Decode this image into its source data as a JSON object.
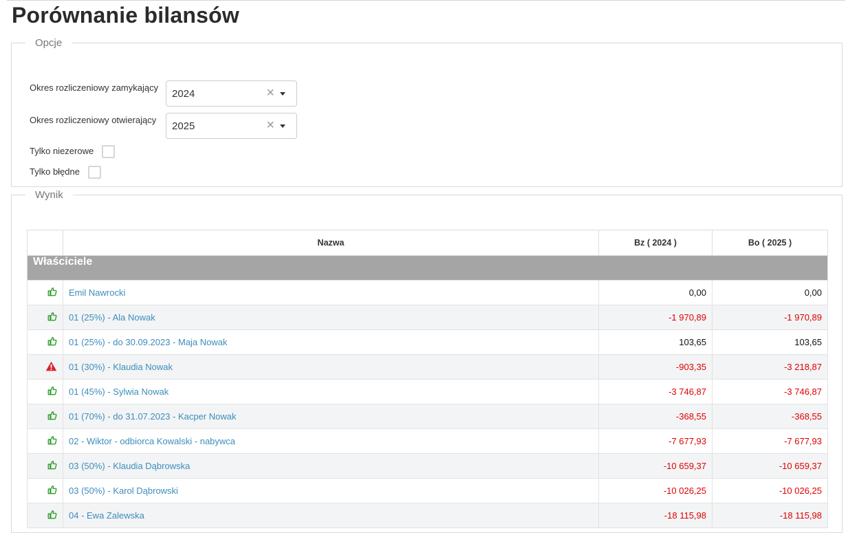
{
  "page": {
    "title": "Porównanie bilansów"
  },
  "options": {
    "legend": "Opcje",
    "closing_label": "Okres rozliczeniowy zamykający",
    "closing_value": "2024",
    "opening_label": "Okres rozliczeniowy otwierający",
    "opening_value": "2025",
    "nonzero_label": "Tylko niezerowe",
    "nonzero_checked": false,
    "errors_label": "Tylko błędne",
    "errors_checked": false
  },
  "result": {
    "legend": "Wynik",
    "columns": {
      "name": "Nazwa",
      "bz": "Bz ( 2024 )",
      "bo": "Bo ( 2025 )"
    },
    "group": "Właściciele",
    "rows": [
      {
        "status": "ok",
        "status_icon": "thumbs-up-icon",
        "name": "Emil Nawrocki",
        "bz": "0,00",
        "bo": "0,00"
      },
      {
        "status": "ok",
        "status_icon": "thumbs-up-icon",
        "name": "01 (25%) - Ala Nowak",
        "bz": "-1 970,89",
        "bo": "-1 970,89"
      },
      {
        "status": "ok",
        "status_icon": "thumbs-up-icon",
        "name": "01 (25%) - do 30.09.2023 - Maja Nowak",
        "bz": "103,65",
        "bo": "103,65"
      },
      {
        "status": "error",
        "status_icon": "warning-icon",
        "name": "01 (30%) - Klaudia Nowak",
        "bz": "-903,35",
        "bo": "-3 218,87"
      },
      {
        "status": "ok",
        "status_icon": "thumbs-up-icon",
        "name": "01 (45%) - Sylwia Nowak",
        "bz": "-3 746,87",
        "bo": "-3 746,87"
      },
      {
        "status": "ok",
        "status_icon": "thumbs-up-icon",
        "name": "01 (70%) - do 31.07.2023 - Kacper Nowak",
        "bz": "-368,55",
        "bo": "-368,55"
      },
      {
        "status": "ok",
        "status_icon": "thumbs-up-icon",
        "name": "02 - Wiktor - odbiorca Kowalski - nabywca",
        "bz": "-7 677,93",
        "bo": "-7 677,93"
      },
      {
        "status": "ok",
        "status_icon": "thumbs-up-icon",
        "name": "03 (50%) - Klaudia Dąbrowska",
        "bz": "-10 659,37",
        "bo": "-10 659,37"
      },
      {
        "status": "ok",
        "status_icon": "thumbs-up-icon",
        "name": "03 (50%) - Karol Dąbrowski",
        "bz": "-10 026,25",
        "bo": "-10 026,25"
      },
      {
        "status": "ok",
        "status_icon": "thumbs-up-icon",
        "name": "04 - Ewa Zalewska",
        "bz": "-18 115,98",
        "bo": "-18 115,98"
      }
    ]
  },
  "colors": {
    "link": "#3c8dbc",
    "negative": "#e00000",
    "ok_icon": "#2e9e2e",
    "warning_icon": "#d9232d",
    "group_header_bg": "#a5a5a5"
  }
}
